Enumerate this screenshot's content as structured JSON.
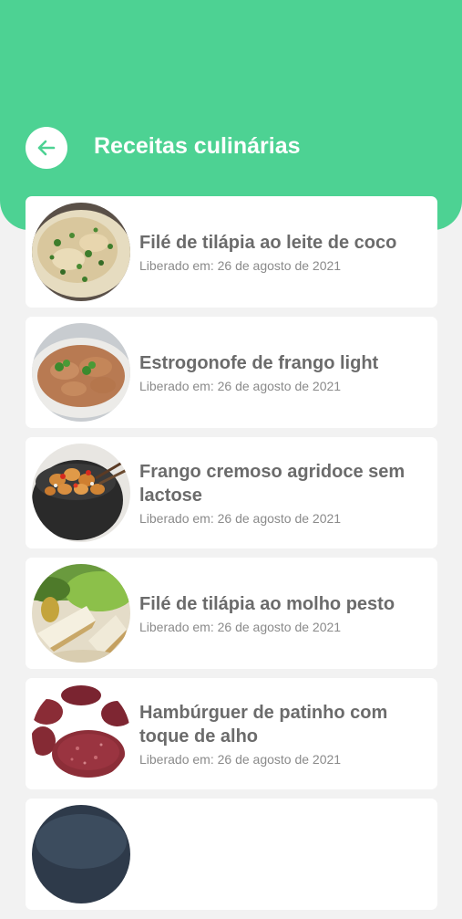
{
  "header": {
    "title": "Receitas culinárias",
    "back_icon": "arrow-left-icon",
    "background_color": "#4dd293"
  },
  "recipes": [
    {
      "title": "Filé de tilápia ao leite de coco",
      "date": "Liberado em: 26 de agosto de 2021"
    },
    {
      "title": "Estrogonofe de frango light",
      "date": "Liberado em: 26 de agosto de 2021"
    },
    {
      "title": "Frango cremoso agridoce sem lactose",
      "date": "Liberado em: 26 de agosto de 2021"
    },
    {
      "title": "Filé de tilápia ao molho pesto",
      "date": "Liberado em: 26 de agosto de 2021"
    },
    {
      "title": "Hambúrguer de patinho com toque de alho",
      "date": "Liberado em: 26 de agosto de 2021"
    },
    {
      "title": "",
      "date": ""
    }
  ]
}
